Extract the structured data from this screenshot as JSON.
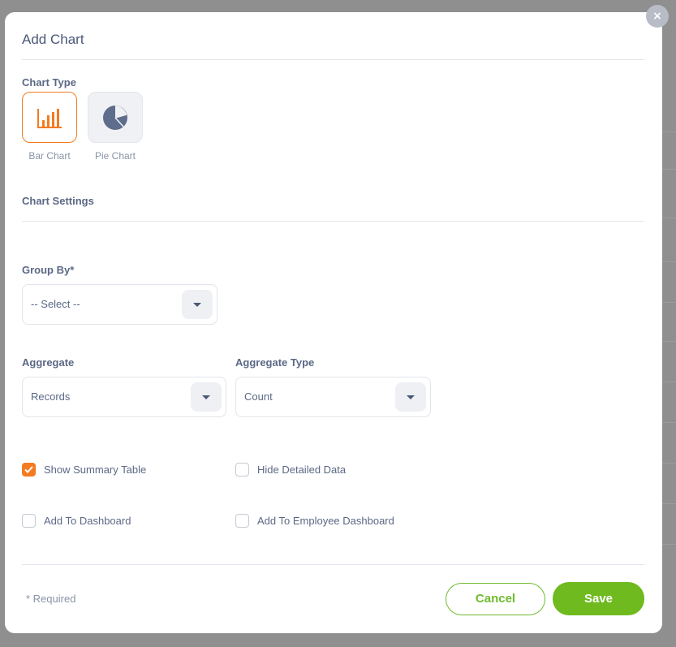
{
  "dialog": {
    "title": "Add Chart",
    "close_icon": "×"
  },
  "chart_type": {
    "label": "Chart Type",
    "options": [
      {
        "label": "Bar Chart",
        "icon": "bar-chart-icon",
        "selected": true
      },
      {
        "label": "Pie Chart",
        "icon": "pie-chart-icon",
        "selected": false
      }
    ]
  },
  "chart_settings": {
    "label": "Chart Settings"
  },
  "group_by": {
    "label": "Group By*",
    "value": "-- Select --"
  },
  "aggregate": {
    "label": "Aggregate",
    "value": "Records"
  },
  "aggregate_type": {
    "label": "Aggregate Type",
    "value": "Count"
  },
  "checkboxes": {
    "show_summary_table": {
      "label": "Show Summary Table",
      "checked": true
    },
    "hide_detailed_data": {
      "label": "Hide Detailed Data",
      "checked": false
    },
    "add_to_dashboard": {
      "label": "Add To Dashboard",
      "checked": false
    },
    "add_to_employee_dashboard": {
      "label": "Add To Employee Dashboard",
      "checked": false
    }
  },
  "footer": {
    "required_note": "* Required",
    "cancel_label": "Cancel",
    "save_label": "Save"
  },
  "colors": {
    "accent": "#f47b20",
    "save_green": "#6fbb1f",
    "text": "#5b6885"
  }
}
